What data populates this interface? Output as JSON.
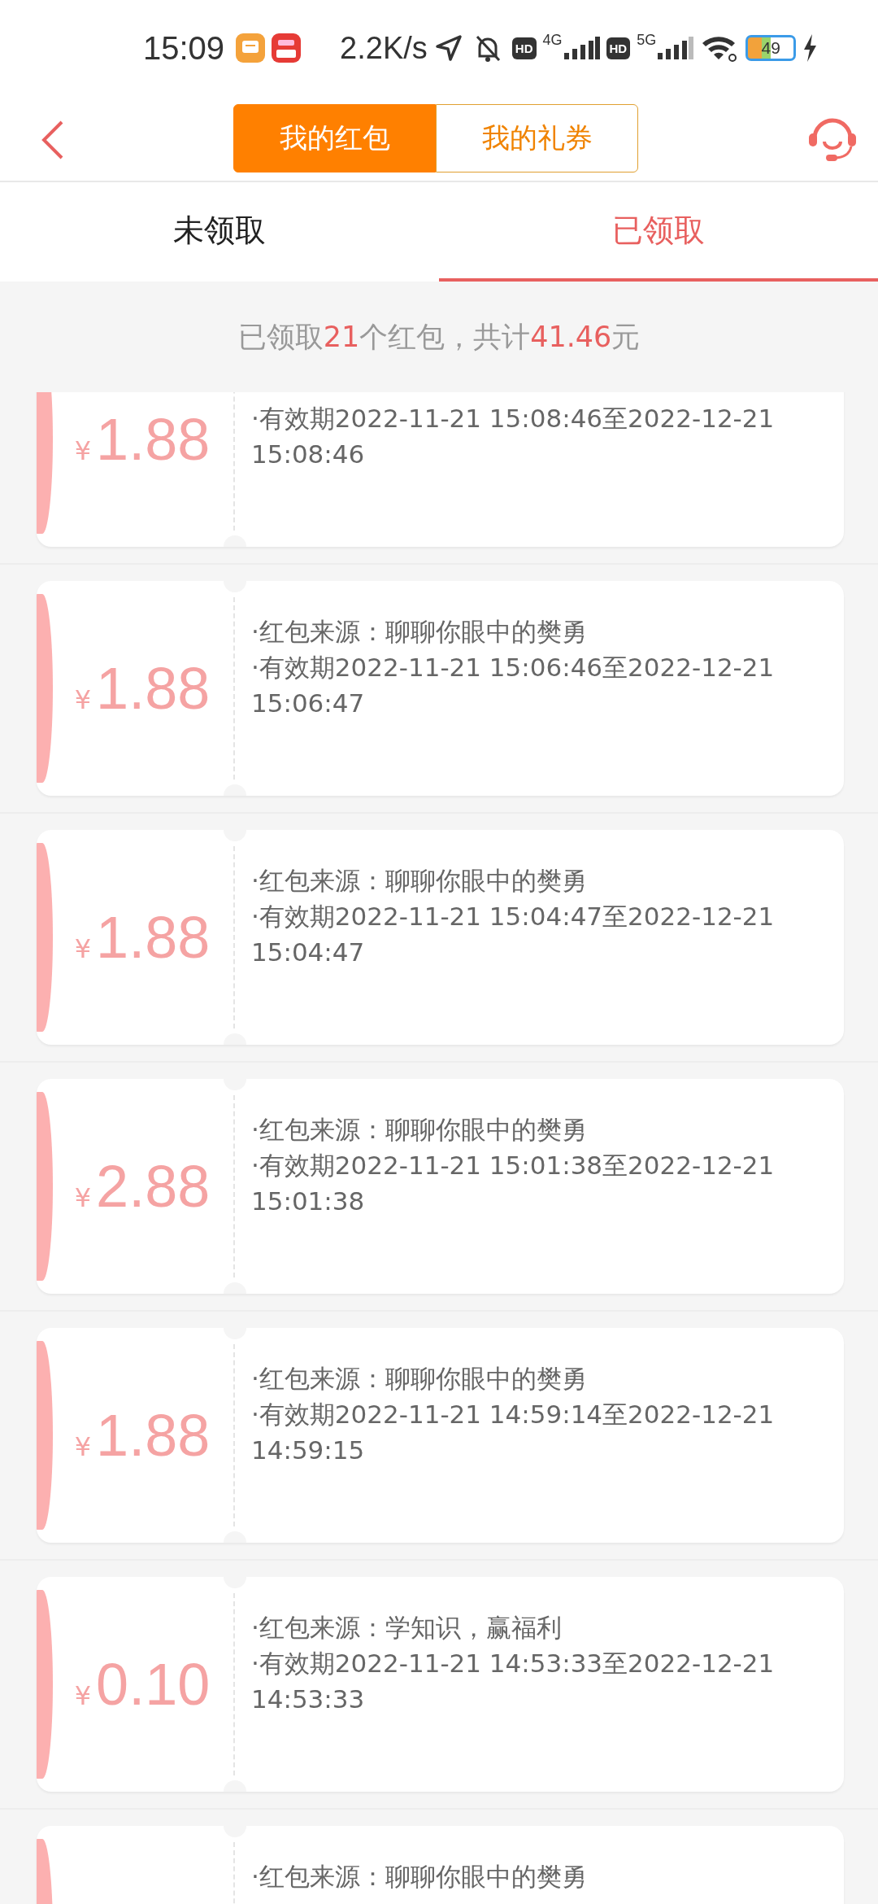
{
  "status_bar": {
    "time": "15:09",
    "net_speed": "2.2K/s",
    "sim1": {
      "hd": "HD",
      "network": "4G"
    },
    "sim2": {
      "hd": "HD",
      "network": "5G"
    },
    "battery": "49"
  },
  "header": {
    "segments": [
      {
        "label": "我的红包",
        "selected": true
      },
      {
        "label": "我的礼券",
        "selected": false
      }
    ]
  },
  "tabs": [
    {
      "label": "未领取",
      "selected": false
    },
    {
      "label": "已领取",
      "selected": true
    }
  ],
  "summary": [
    {
      "text": "已领取",
      "highlight": false
    },
    {
      "text": "21",
      "highlight": true
    },
    {
      "text": "个红包，共计",
      "highlight": false
    },
    {
      "text": "41.46",
      "highlight": true
    },
    {
      "text": "元",
      "highlight": false
    }
  ],
  "cards": [
    {
      "currency": "¥",
      "amount": "1.88",
      "validity": "·有效期2022-11-21 15:08:46至2022-12-21 15:08:46"
    },
    {
      "currency": "¥",
      "amount": "1.88",
      "source": "·红包来源：聊聊你眼中的樊勇",
      "validity": "·有效期2022-11-21 15:06:46至2022-12-21 15:06:47"
    },
    {
      "currency": "¥",
      "amount": "1.88",
      "source": "·红包来源：聊聊你眼中的樊勇",
      "validity": "·有效期2022-11-21 15:04:47至2022-12-21 15:04:47"
    },
    {
      "currency": "¥",
      "amount": "2.88",
      "source": "·红包来源：聊聊你眼中的樊勇",
      "validity": "·有效期2022-11-21 15:01:38至2022-12-21 15:01:38"
    },
    {
      "currency": "¥",
      "amount": "1.88",
      "source": "·红包来源：聊聊你眼中的樊勇",
      "validity": "·有效期2022-11-21 14:59:14至2022-12-21 14:59:15"
    },
    {
      "currency": "¥",
      "amount": "0.10",
      "source": "·红包来源：学知识，赢福利",
      "validity": "·有效期2022-11-21 14:53:33至2022-12-21 14:53:33"
    },
    {
      "source": "·红包来源：聊聊你眼中的樊勇"
    }
  ]
}
